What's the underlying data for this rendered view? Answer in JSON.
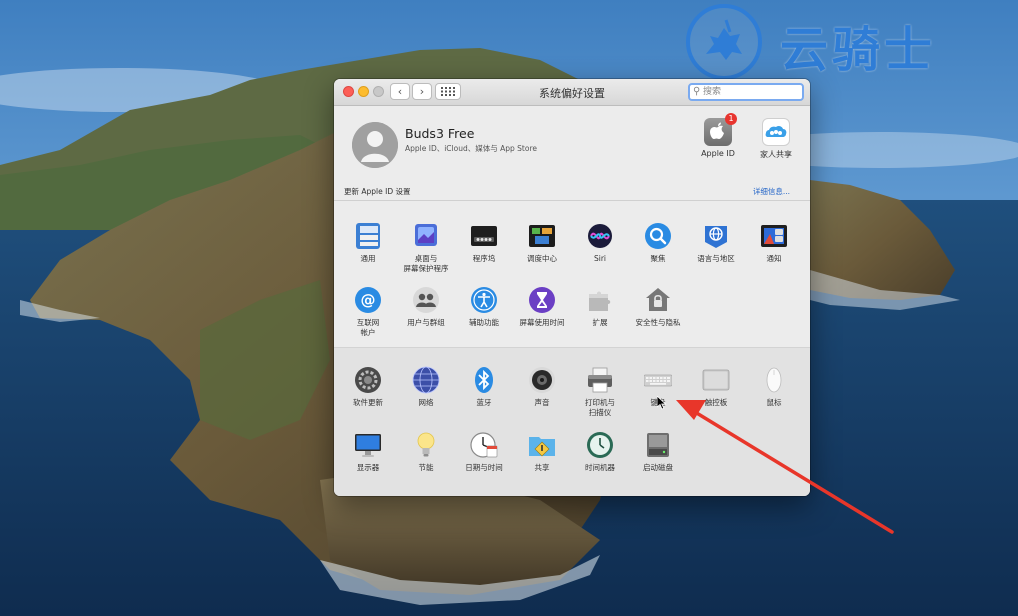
{
  "watermark": {
    "text": "云骑士"
  },
  "window": {
    "title": "系统偏好设置",
    "search_placeholder": "搜索",
    "nav": {
      "back": "‹",
      "forward": "›"
    }
  },
  "account": {
    "name": "Buds3 Free",
    "subtitle": "Apple ID、iCloud、媒体与 App Store",
    "update_text": "更新 Apple ID 设置",
    "details_link": "详细信息...",
    "apple_id_label": "Apple ID",
    "apple_id_badge": "1",
    "family_label": "家人共享"
  },
  "panes_row1": [
    {
      "label": "通用",
      "icon": "general-icon"
    },
    {
      "label": "桌面与\n屏幕保护程序",
      "icon": "desktop-screensaver-icon"
    },
    {
      "label": "程序坞",
      "icon": "dock-icon"
    },
    {
      "label": "调度中心",
      "icon": "mission-control-icon"
    },
    {
      "label": "Siri",
      "icon": "siri-icon"
    },
    {
      "label": "聚焦",
      "icon": "spotlight-icon"
    },
    {
      "label": "语言与地区",
      "icon": "language-region-icon"
    },
    {
      "label": "通知",
      "icon": "notifications-icon"
    }
  ],
  "panes_row2": [
    {
      "label": "互联网\n帐户",
      "icon": "internet-accounts-icon"
    },
    {
      "label": "用户与群组",
      "icon": "users-groups-icon"
    },
    {
      "label": "辅助功能",
      "icon": "accessibility-icon"
    },
    {
      "label": "屏幕使用时间",
      "icon": "screen-time-icon"
    },
    {
      "label": "扩展",
      "icon": "extensions-icon"
    },
    {
      "label": "安全性与隐私",
      "icon": "security-privacy-icon"
    }
  ],
  "panes_row3": [
    {
      "label": "软件更新",
      "icon": "software-update-icon"
    },
    {
      "label": "网络",
      "icon": "network-icon"
    },
    {
      "label": "蓝牙",
      "icon": "bluetooth-icon"
    },
    {
      "label": "声音",
      "icon": "sound-icon"
    },
    {
      "label": "打印机与\n扫描仪",
      "icon": "printer-scanner-icon"
    },
    {
      "label": "键盘",
      "icon": "keyboard-icon"
    },
    {
      "label": "触控板",
      "icon": "trackpad-icon"
    },
    {
      "label": "鼠标",
      "icon": "mouse-icon"
    }
  ],
  "panes_row4": [
    {
      "label": "显示器",
      "icon": "displays-icon"
    },
    {
      "label": "节能",
      "icon": "energy-saver-icon"
    },
    {
      "label": "日期与时间",
      "icon": "date-time-icon"
    },
    {
      "label": "共享",
      "icon": "sharing-icon"
    },
    {
      "label": "时间机器",
      "icon": "time-machine-icon"
    },
    {
      "label": "启动磁盘",
      "icon": "startup-disk-icon"
    }
  ],
  "colors": {
    "accent_link": "#2465c7",
    "watermark": "#2f7dd6",
    "annotation_arrow": "#e8362a"
  }
}
